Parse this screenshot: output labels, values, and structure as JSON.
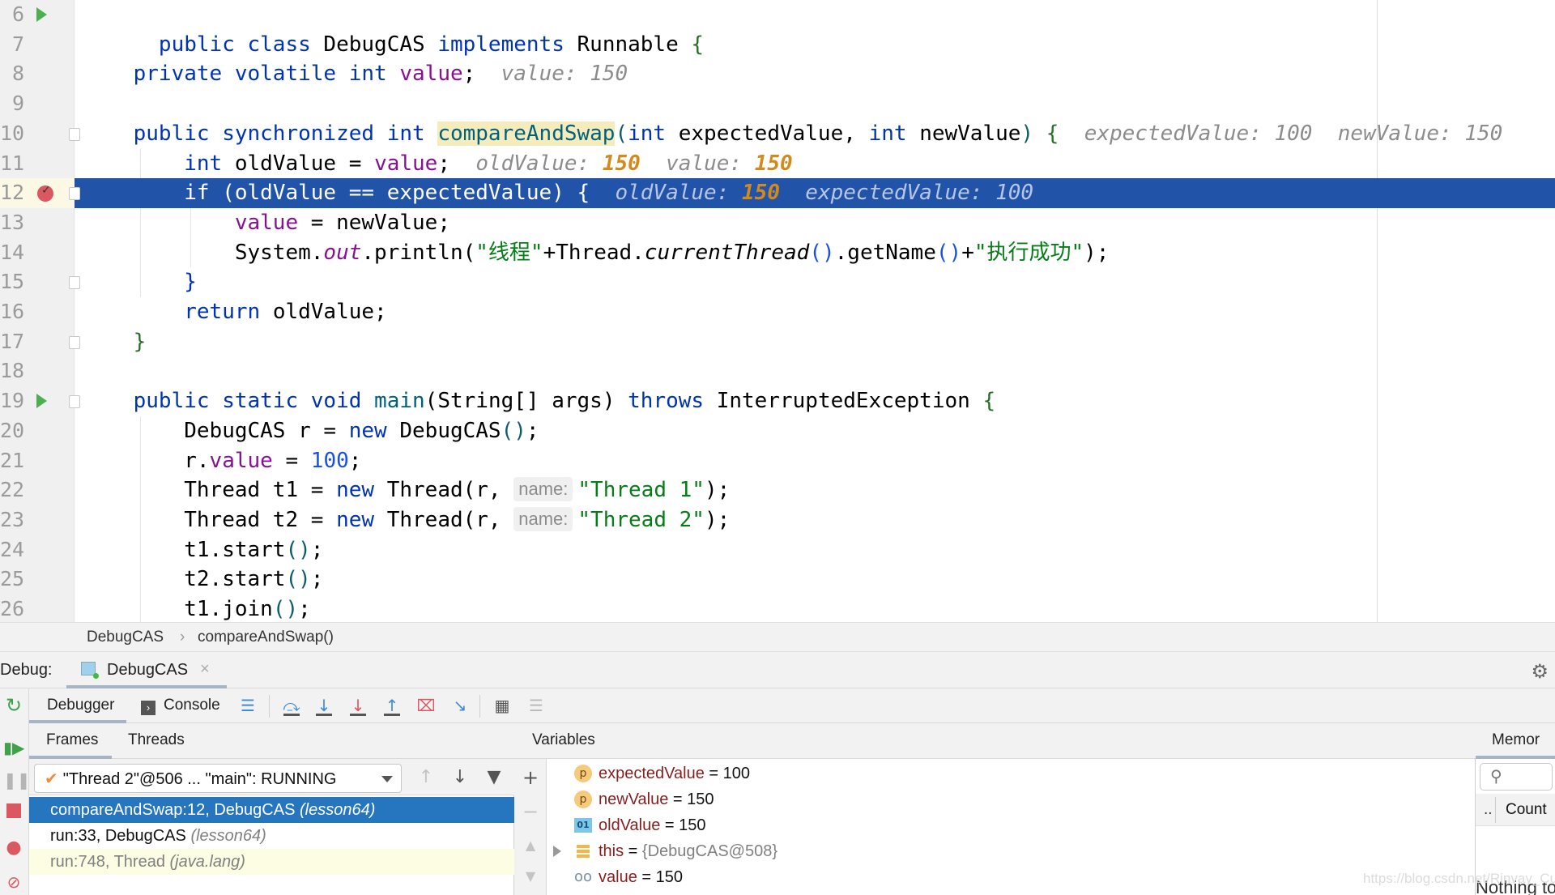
{
  "editor": {
    "lines": [
      {
        "num": "6",
        "gutter": "run"
      },
      {
        "num": "7"
      },
      {
        "num": "8"
      },
      {
        "num": "9"
      },
      {
        "num": "10",
        "fold": true
      },
      {
        "num": "11"
      },
      {
        "num": "12",
        "gutter": "breakpoint",
        "fold": true,
        "current": true
      },
      {
        "num": "13"
      },
      {
        "num": "14"
      },
      {
        "num": "15",
        "fold": true
      },
      {
        "num": "16"
      },
      {
        "num": "17",
        "fold": true
      },
      {
        "num": "18"
      },
      {
        "num": "19",
        "gutter": "run",
        "fold": true
      },
      {
        "num": "20"
      },
      {
        "num": "21"
      },
      {
        "num": "22"
      },
      {
        "num": "23"
      },
      {
        "num": "24"
      },
      {
        "num": "25"
      },
      {
        "num": "26"
      }
    ],
    "code": {
      "l6": {
        "kw1": "public class",
        "name": "DebugCAS",
        "kw2": "implements",
        "iface": "Runnable",
        "brace": "{"
      },
      "l8": {
        "kw": "private volatile int",
        "field": "value",
        "semi": ";",
        "inlay_label": "value:",
        "inlay_value": "150"
      },
      "l10": {
        "kw": "public synchronized int",
        "method": "compareAndSwap",
        "open": "(",
        "kw_int1": "int",
        "p1": "expectedValue,",
        "kw_int2": "int",
        "p2": "newValue",
        "close": ")",
        "brace": "{",
        "inlay1_label": "expectedValue: 100",
        "inlay2_label": "newValue: 150"
      },
      "l11": {
        "kw": "int",
        "var": "oldValue =",
        "field": "value",
        "semi": ";",
        "inlay1_label": "oldValue:",
        "inlay1_value": "150",
        "inlay2_label": "value:",
        "inlay2_value": "150"
      },
      "l12": {
        "kw": "if",
        "cond": "(oldValue == expectedValue) {",
        "inlay1_label": "oldValue:",
        "inlay1_value": "150",
        "inlay2_label": "expectedValue: 100"
      },
      "l13": {
        "field": "value",
        "rest": "= newValue;"
      },
      "l14": {
        "p1": "System.",
        "out": "out",
        "p2": ".println(",
        "s1": "\"线程\"",
        "p3": "+Thread.",
        "ct": "currentThread",
        "paren1": "()",
        "p4": ".getName",
        "paren2": "()",
        "p5": "+",
        "s2": "\"执行成功\"",
        "p6": ");"
      },
      "l15": {
        "brace": "}"
      },
      "l16": {
        "kw": "return",
        "rest": "oldValue;"
      },
      "l17": {
        "brace": "}"
      },
      "l19": {
        "kw": "public static void",
        "method": "main",
        "rest": "(String[] args)",
        "kw2": "throws",
        "exc": "InterruptedException",
        "brace": "{"
      },
      "l20": {
        "p1": "DebugCAS r =",
        "kw": "new",
        "p2": "DebugCAS",
        "paren": "()",
        "semi": ";"
      },
      "l21": {
        "p1": "r.",
        "field": "value",
        "p2": " = ",
        "num": "100",
        "semi": ";"
      },
      "l22": {
        "p1": "Thread t1 =",
        "kw": "new",
        "p2": "Thread(r,",
        "hint": "name:",
        "str": "\"Thread 1\"",
        "end": ");"
      },
      "l23": {
        "p1": "Thread t2 =",
        "kw": "new",
        "p2": "Thread(r,",
        "hint": "name:",
        "str": "\"Thread 2\"",
        "end": ");"
      },
      "l24": {
        "p1": "t1.start",
        "paren": "()",
        "semi": ";"
      },
      "l25": {
        "p1": "t2.start",
        "paren": "()",
        "semi": ";"
      },
      "l26": {
        "p1": "t1.join",
        "paren": "()",
        "semi": ";"
      }
    }
  },
  "breadcrumb": {
    "items": [
      "DebugCAS",
      "compareAndSwap()"
    ],
    "separator": "›"
  },
  "debug": {
    "label": "Debug:",
    "tab_label": "DebugCAS",
    "tab_close": "×",
    "settings_icon": "gear-icon"
  },
  "toolbar": {
    "debugger_tab": "Debugger",
    "console_tab": "Console"
  },
  "frames": {
    "tabs": [
      "Frames",
      "Threads"
    ],
    "thread_selector": "\"Thread 2\"@506 ... \"main\": RUNNING",
    "rows": [
      {
        "method": "compareAndSwap:12, DebugCAS",
        "pkg": "(lesson64)",
        "selected": true
      },
      {
        "method": "run:33, DebugCAS",
        "pkg": "(lesson64)"
      },
      {
        "method": "run:748, Thread",
        "pkg": "(java.lang)",
        "library": true
      }
    ]
  },
  "variables": {
    "header": "Variables",
    "rows": [
      {
        "icon": "p",
        "type": "param",
        "name": "expectedValue",
        "eq": " = ",
        "value": "100"
      },
      {
        "icon": "p",
        "type": "param",
        "name": "newValue",
        "eq": " = ",
        "value": "150"
      },
      {
        "icon": "01",
        "type": "local",
        "name": "oldValue",
        "eq": " = ",
        "value": "150"
      },
      {
        "icon": "",
        "type": "object",
        "name": "this",
        "eq": " = ",
        "value": "{DebugCAS@508}",
        "expandable": true
      },
      {
        "icon": "oo",
        "type": "watch",
        "name": "value",
        "eq": " = ",
        "value": "150"
      }
    ]
  },
  "memory": {
    "header": "Memor",
    "search_placeholder": "",
    "col_dots": "..",
    "col_count": "Count",
    "empty_text": "Nothing to"
  },
  "watermark": "https://blog.csdn.net/Rinvay_Cui",
  "colors": {
    "current_line": "#2154a8",
    "selected_frame": "#2675bf",
    "keyword": "#0033b3",
    "field": "#871094",
    "string": "#067d17",
    "inlay_value": "#d4891c"
  }
}
